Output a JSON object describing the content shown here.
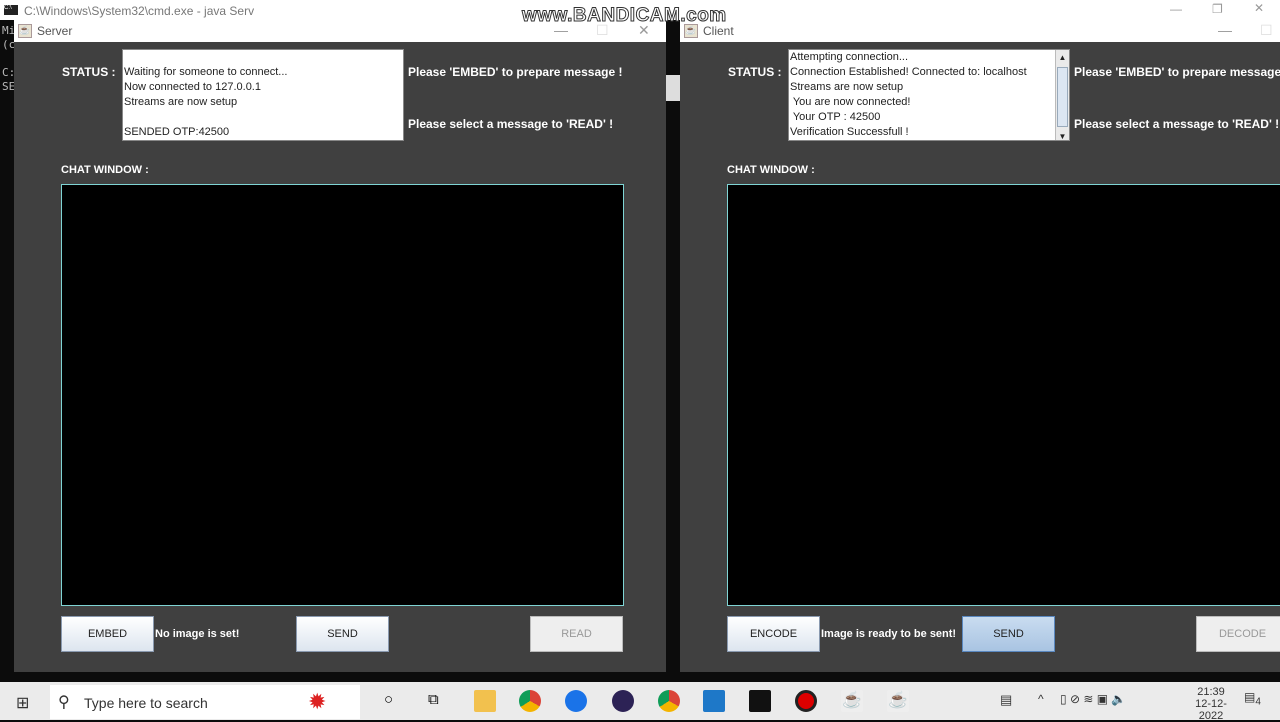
{
  "cmd": {
    "title": "C:\\Windows\\System32\\cmd.exe - java  Serv",
    "lines": [
      "Mi",
      "(c",
      "",
      "C:",
      "SE"
    ]
  },
  "watermark": "www.BANDICAM.com",
  "server": {
    "title": "Server",
    "status_label": "STATUS :",
    "status_lines": [
      "Waiting for someone to connect...",
      "Now connected to 127.0.0.1",
      "Streams are now setup",
      "",
      "SENDED OTP:42500"
    ],
    "hint_embed": "Please 'EMBED' to prepare message !",
    "hint_read": "Please select a message to 'READ' !",
    "chat_label": "CHAT WINDOW :",
    "btn_embed": "EMBED",
    "image_status": "No image is set!",
    "btn_send": "SEND",
    "btn_read": "READ"
  },
  "client": {
    "title": "Client",
    "status_label": "STATUS :",
    "status_lines": [
      "Attempting connection...",
      "Connection Established! Connected to: localhost",
      "Streams are now setup",
      " You are now connected!",
      " Your OTP : 42500",
      "Verification Successfull !"
    ],
    "hint_embed": "Please 'EMBED' to prepare message !",
    "hint_read": "Please select a message to 'READ' !",
    "chat_label": "CHAT WINDOW :",
    "btn_encode": "ENCODE",
    "image_status": "Image is ready to be sent!",
    "btn_send": "SEND",
    "btn_decode": "DECODE"
  },
  "taskbar": {
    "search_placeholder": "Type here to search",
    "time": "21:39",
    "date": "12-12-2022",
    "notifications": "4"
  }
}
